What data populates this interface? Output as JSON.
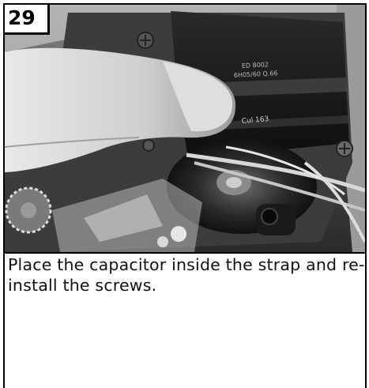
{
  "step": {
    "number": "29"
  },
  "photo": {
    "description_icon": "photo-image",
    "label_line1": "ED 8002",
    "label_line2": "6H05/60 Q.66",
    "label_line3": "Cul 163"
  },
  "instructions": {
    "text": "Place the capacitor inside the strap and re-install the screws."
  },
  "colors": {
    "border": "#000000",
    "background": "#ffffff",
    "text": "#111111"
  }
}
